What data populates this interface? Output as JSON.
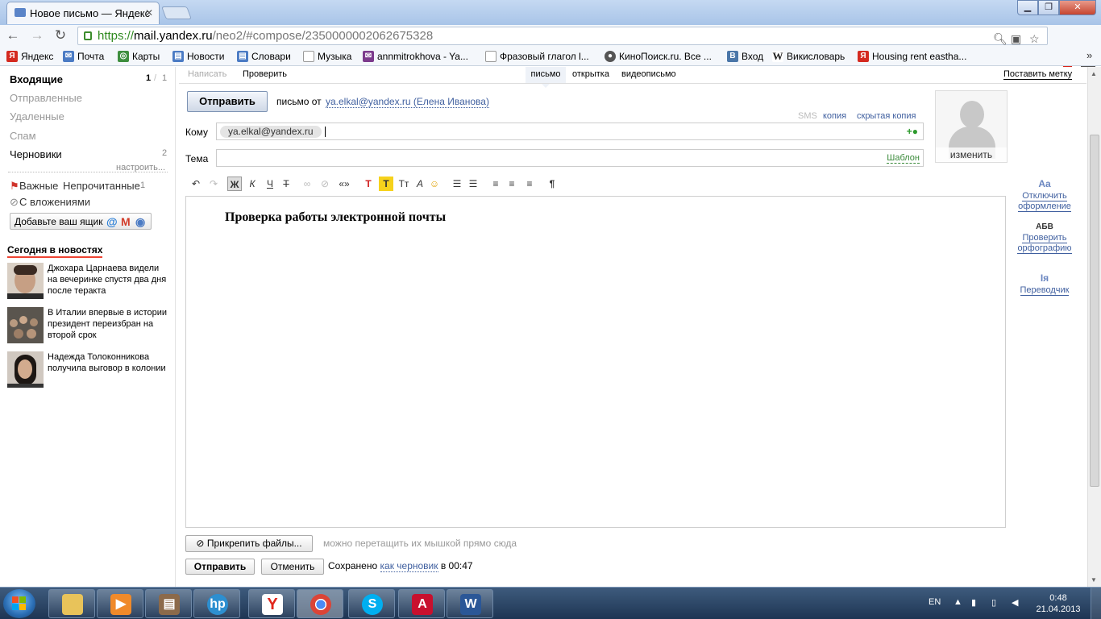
{
  "browser": {
    "tab_title": "Новое письмо — Яндекс",
    "url_scheme": "https://",
    "url_host": "mail.yandex.ru",
    "url_path": "/neo2/#compose/2350000002062675328",
    "ext_badge": "1",
    "bookmarks": [
      {
        "label": "Яндекс",
        "icon": "Я",
        "color": "#d42a20"
      },
      {
        "label": "Почта",
        "icon": "✉",
        "color": "#4b7bc4"
      },
      {
        "label": "Карты",
        "icon": "◎",
        "color": "#3e8e3e"
      },
      {
        "label": "Новости",
        "icon": "▤",
        "color": "#4b7bc4"
      },
      {
        "label": "Словари",
        "icon": "▤",
        "color": "#4b7bc4"
      },
      {
        "label": "Музыка",
        "icon": "▯",
        "color": "#9aa5b5"
      },
      {
        "label": "annmitrokhova - Ya...",
        "icon": "✉",
        "color": "#7c3a8c"
      },
      {
        "label": "Фразовый глагол l...",
        "icon": "▯",
        "color": "#9aa5b5"
      },
      {
        "label": "КиноПоиск.ru. Все ...",
        "icon": "●",
        "color": "#555"
      },
      {
        "label": "Вход",
        "icon": "B",
        "color": "#4a76a8"
      },
      {
        "label": "Викисловарь",
        "icon": "W",
        "color": "#555"
      },
      {
        "label": "Housing rent eastha...",
        "icon": "Я",
        "color": "#d42a20"
      }
    ]
  },
  "sidebar": {
    "folders": [
      {
        "label": "Входящие",
        "count": "1",
        "count2": "1"
      },
      {
        "label": "Отправленные"
      },
      {
        "label": "Удаленные"
      },
      {
        "label": "Спам"
      },
      {
        "label": "Черновики",
        "count": "2"
      }
    ],
    "configure": "настроить...",
    "filter_important": "Важные",
    "filter_unread": "Непрочитанные",
    "filter_unread_count": "1",
    "filter_attach": "С вложениями",
    "add_box": "Добавьте ваш ящик",
    "news_title": "Сегодня в новостях",
    "news": [
      {
        "text": "Джохара Царнаева видели на вечеринке спустя два дня после теракта"
      },
      {
        "text": "В Италии впервые в истории президент переизбран на второй срок"
      },
      {
        "text": "Надежда Толоконникова получила выговор в колонии"
      }
    ]
  },
  "compose": {
    "tab_write": "Написать",
    "tab_check": "Проверить",
    "tab_letter": "письмо",
    "tab_postcard": "открытка",
    "tab_video": "видеописьмо",
    "set_label": "Поставить метку",
    "send": "Отправить",
    "from_prefix": "письмо от",
    "from_address": "ya.elkal@yandex.ru (Елена Иванова)",
    "sms": "SMS",
    "cc": "копия",
    "bcc": "скрытая копия",
    "to_label": "Кому",
    "to_chip": "ya.elkal@yandex.ru",
    "subject_label": "Тема",
    "template": "Шаблон",
    "avatar_change": "изменить",
    "body_text": "Проверка работы электронной почты",
    "right_tools": [
      {
        "icon": "Aa",
        "label1": "Отключить",
        "label2": "оформление"
      },
      {
        "icon": "АБВ",
        "label1": "Проверить",
        "label2": "орфографию"
      },
      {
        "icon": "Iя",
        "label1": "Переводчик",
        "label2": ""
      }
    ],
    "attach": "Прикрепить файлы...",
    "drag_hint": "можно перетащить их мышкой прямо сюда",
    "cancel": "Отменить",
    "saved_prefix": "Сохранено",
    "saved_link": "как черновик",
    "saved_suffix": "в 00:47"
  },
  "taskbar": {
    "lang": "EN",
    "time": "0:48",
    "date": "21.04.2013"
  }
}
